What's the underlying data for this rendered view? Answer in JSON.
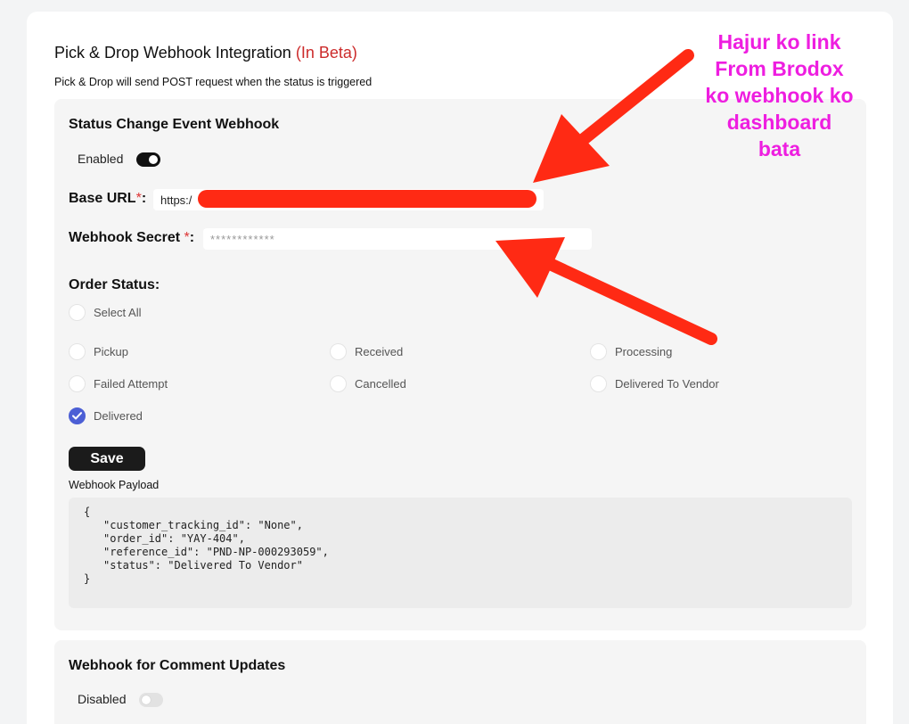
{
  "header": {
    "title": "Pick & Drop Webhook Integration",
    "beta": "(In Beta)",
    "subtitle": "Pick & Drop will send POST request when the status is triggered"
  },
  "status_webhook": {
    "title": "Status Change Event Webhook",
    "toggle_label": "Enabled",
    "enabled": true,
    "base_url_label": "Base URL",
    "base_url_value": "https:/",
    "secret_label": "Webhook Secret ",
    "secret_placeholder": "************",
    "required_mark": "*",
    "colon": ":"
  },
  "order_status": {
    "title": "Order Status:",
    "select_all": "Select All",
    "items": [
      {
        "label": "Pickup",
        "checked": false
      },
      {
        "label": "Received",
        "checked": false
      },
      {
        "label": "Processing",
        "checked": false
      },
      {
        "label": "Failed Attempt",
        "checked": false
      },
      {
        "label": "Cancelled",
        "checked": false
      },
      {
        "label": "Delivered To Vendor",
        "checked": false
      },
      {
        "label": "Delivered",
        "checked": true
      }
    ]
  },
  "save_label": "Save",
  "payload": {
    "label": "Webhook Payload",
    "open": "{",
    "lines": [
      "\"customer_tracking_id\": \"None\",",
      "\"order_id\": \"YAY-404\",",
      "\"reference_id\": \"PND-NP-000293059\",",
      "\"status\": \"Delivered To Vendor\""
    ],
    "close": "}"
  },
  "comment_webhook": {
    "title": "Webhook for Comment Updates",
    "toggle_label": "Disabled",
    "enabled": false
  },
  "annotation": {
    "lines": [
      "Hajur ko link",
      "From Brodox",
      "ko webhook ko",
      "dashboard",
      "bata"
    ]
  },
  "colors": {
    "beta": "#cc2b2b",
    "annotation": "#ee1ee0",
    "arrow": "#ff2a14",
    "checkbox_checked": "#4c5fd5"
  }
}
